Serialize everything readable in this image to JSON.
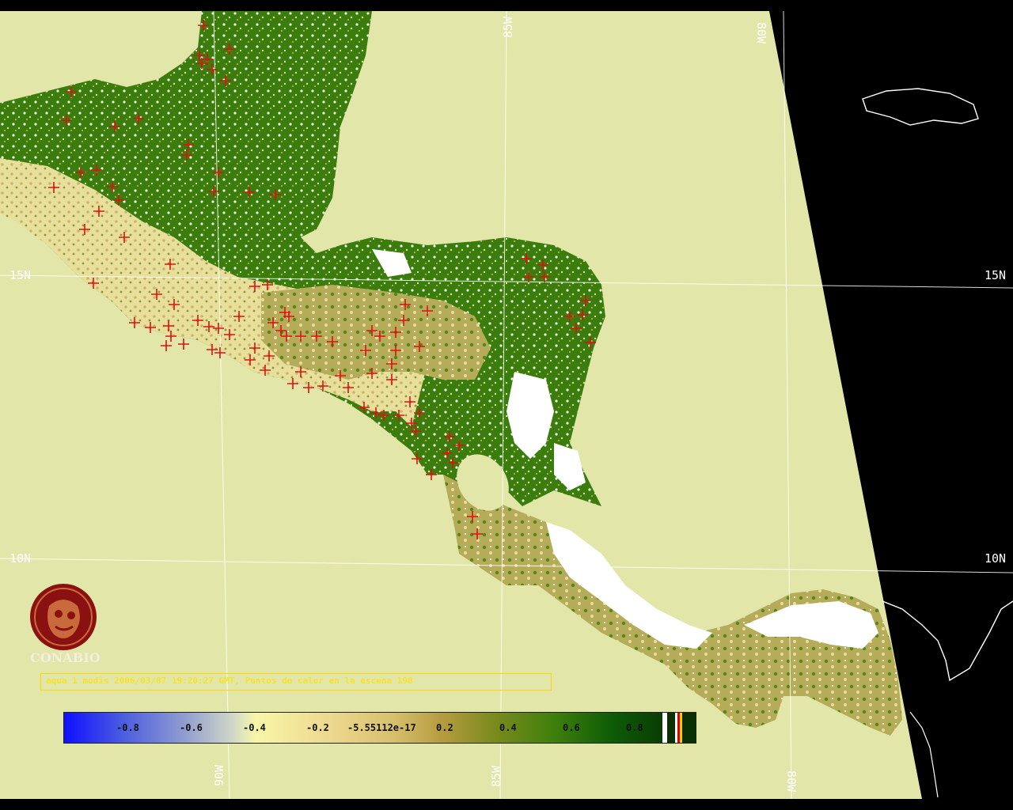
{
  "map": {
    "latitude_labels": [
      "15N",
      "15N",
      "10N",
      "10N"
    ],
    "longitude_labels": [
      "85W",
      "80W",
      "90W",
      "85W",
      "80W"
    ],
    "colors": {
      "ocean": "#e2e7a9",
      "space": "#000000",
      "fire_marker": "#e01010",
      "grid": "#ffffff"
    }
  },
  "logo": {
    "icon": "conabio-logo-icon",
    "text": "CONABIO"
  },
  "caption": {
    "text": "aqua 1 modis 2006/03/07 19:20:27 GMT, Puntos de calor en la escena 198"
  },
  "colorbar": {
    "ticks": [
      "-0.8",
      "-0.6",
      "-0.4",
      "-0.2",
      "-5.55112e-17",
      "0.2",
      "0.4",
      "0.6",
      "0.8"
    ]
  }
}
